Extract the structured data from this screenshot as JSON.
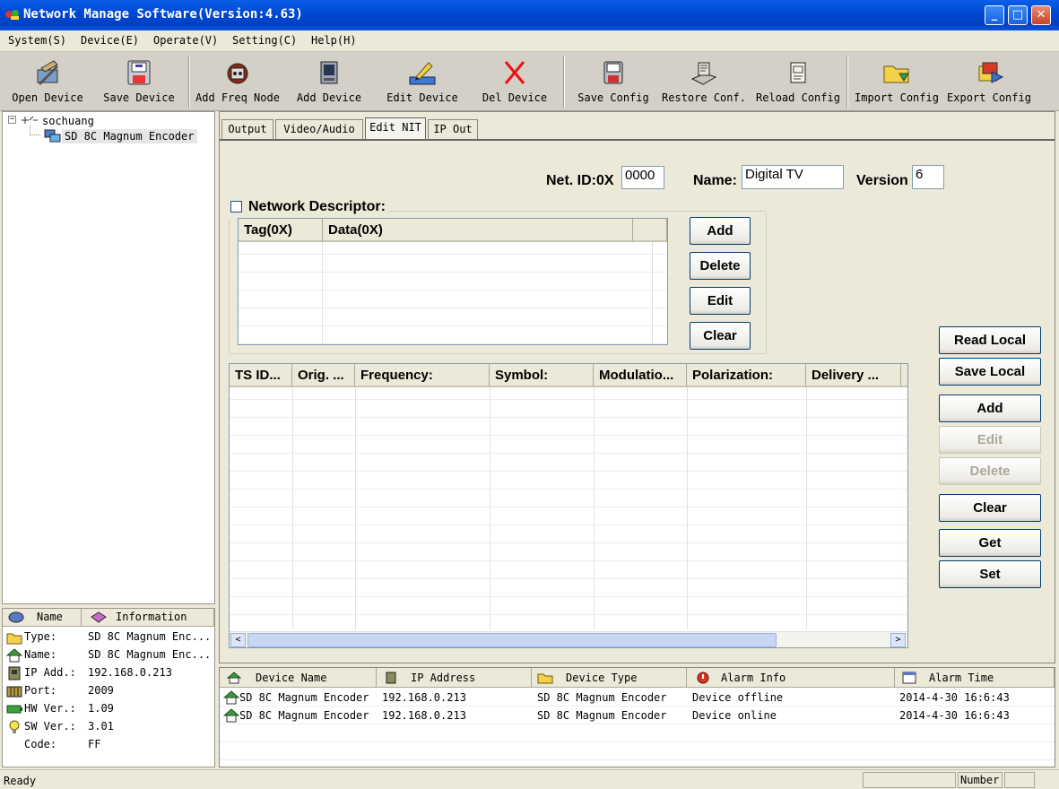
{
  "window": {
    "title": "Network Manage Software(Version:4.63)"
  },
  "menu": [
    "System(S)",
    "Device(E)",
    "Operate(V)",
    "Setting(C)",
    "Help(H)"
  ],
  "toolbar": {
    "open_device": "Open Device",
    "save_device": "Save Device",
    "add_freq_node": "Add Freq Node",
    "add_device": "Add Device",
    "edit_device": "Edit Device",
    "del_device": "Del Device",
    "save_config": "Save Config",
    "restore_conf": "Restore Conf.",
    "reload_config": "Reload Config",
    "import_config": "Import Config",
    "export_config": "Export Config"
  },
  "tree": {
    "root": "sochuang",
    "child": "SD 8C Magnum Encoder"
  },
  "info": {
    "headers": {
      "name": "Name",
      "information": "Information"
    },
    "rows": [
      {
        "label": "Type:",
        "value": "SD 8C Magnum Enc..."
      },
      {
        "label": "Name:",
        "value": "SD 8C Magnum Enc..."
      },
      {
        "label": "IP Add.:",
        "value": "192.168.0.213"
      },
      {
        "label": "Port:",
        "value": "2009"
      },
      {
        "label": "HW Ver.:",
        "value": "1.09"
      },
      {
        "label": "SW Ver.:",
        "value": "3.01"
      },
      {
        "label": "Code:",
        "value": "FF"
      }
    ]
  },
  "tabs": [
    "Output",
    "Video/Audio",
    "Edit NIT",
    "IP Out"
  ],
  "nit": {
    "net_id_label": "Net. ID:0X",
    "net_id_value": "0000",
    "name_label": "Name:",
    "name_value": "Digital TV",
    "version_label": "Version",
    "version_value": "6",
    "network_descriptor_label": "Network Descriptor:",
    "descriptor_columns": [
      "Tag(0X)",
      "Data(0X)"
    ],
    "descriptor_buttons": {
      "add": "Add",
      "delete": "Delete",
      "edit": "Edit",
      "clear": "Clear"
    },
    "ts_columns": [
      "TS ID...",
      "Orig. ...",
      "Frequency:",
      "Symbol:",
      "Modulatio...",
      "Polarization:",
      "Delivery ...",
      "I"
    ],
    "side_buttons": {
      "read_local": "Read Local",
      "save_local": "Save Local",
      "add": "Add",
      "edit": "Edit",
      "delete": "Delete",
      "clear": "Clear",
      "get": "Get",
      "set": "Set"
    }
  },
  "log": {
    "columns": [
      "Device Name",
      "IP Address",
      "Device Type",
      "Alarm Info",
      "Alarm Time"
    ],
    "rows": [
      [
        "SD 8C Magnum Encoder",
        "192.168.0.213",
        "SD 8C Magnum Encoder",
        "Device offline",
        "2014-4-30 16:6:43"
      ],
      [
        "SD 8C Magnum Encoder",
        "192.168.0.213",
        "SD 8C Magnum Encoder",
        "Device online",
        "2014-4-30 16:6:43"
      ]
    ]
  },
  "status": {
    "left": "Ready",
    "number": "Number"
  }
}
